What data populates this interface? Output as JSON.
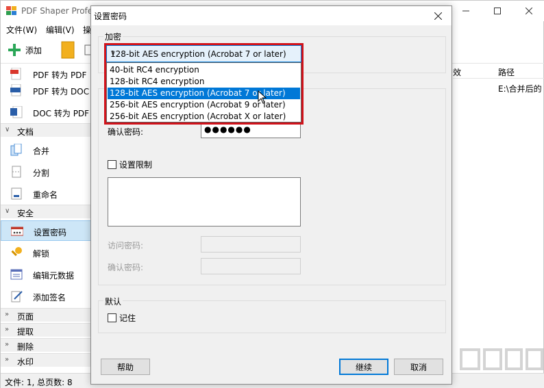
{
  "app": {
    "title": "PDF Shaper Profe",
    "menu": [
      "文件(W)",
      "编辑(V)",
      "操"
    ],
    "toolbar": {
      "add_label": "添加"
    }
  },
  "sidebar": {
    "items_top": [
      {
        "label": "PDF 转为 PDF",
        "icon": "pdf-icon"
      },
      {
        "label": "PDF 转为 DOC",
        "icon": "doc-icon"
      },
      {
        "label": "DOC 转为 PDF",
        "icon": "word-icon"
      }
    ],
    "sections": {
      "document": {
        "label": "文档",
        "items": [
          "合并",
          "分割",
          "重命名"
        ]
      },
      "security": {
        "label": "安全",
        "items": [
          "设置密码",
          "解锁",
          "编辑元数据",
          "添加签名"
        ]
      },
      "collapsed": [
        "页面",
        "提取",
        "删除",
        "水印"
      ]
    }
  },
  "table": {
    "headers": [
      "效",
      "路径"
    ],
    "row": [
      "E:\\合并后的"
    ]
  },
  "status": {
    "text": "文件: 1, 总页数: 8"
  },
  "dialog": {
    "title": "设置密码",
    "encrypt_group": "加密",
    "combo_value": "128-bit AES encryption (Acrobat 7 or later)",
    "options": [
      "40-bit RC4 encryption",
      "128-bit RC4 encryption",
      "128-bit AES encryption (Acrobat 7 or later)",
      "256-bit AES encryption (Acrobat 9 or later)",
      "256-bit AES encryption (Acrobat X or later)"
    ],
    "selected_index": 2,
    "confirm_password_label": "确认密码:",
    "confirm_password_value": "●●●●●●",
    "restrict_label": "设置限制",
    "access_password_label": "访问密码:",
    "access_confirm_label": "确认密码:",
    "default_group": "默认",
    "remember_label": "记住",
    "help_button": "帮助",
    "continue_button": "继续",
    "cancel_button": "取消"
  },
  "colors": {
    "accent": "#0078d7",
    "highlight": "#d0121a",
    "selection_bg": "#cde6f7"
  }
}
